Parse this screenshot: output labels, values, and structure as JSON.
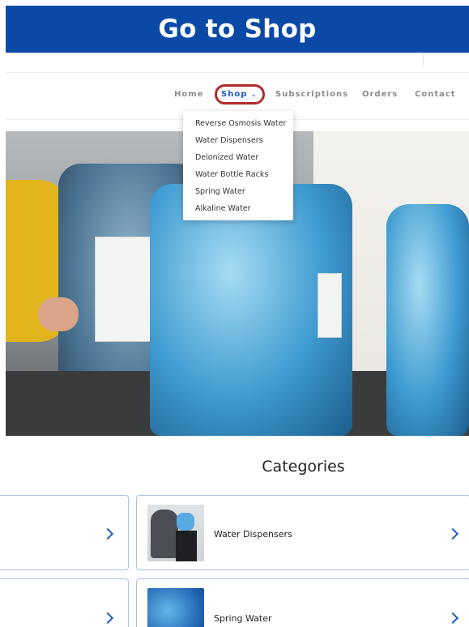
{
  "banner": {
    "title": "Go to Shop"
  },
  "nav": {
    "home": "Home",
    "shop": "Shop",
    "subscriptions": "Subscriptions",
    "orders": "Orders",
    "contact": "Contact",
    "shop_chevron_icon": "chevron-down-icon"
  },
  "shop_menu": {
    "items": [
      "Reverse Osmosis Water",
      "Water Dispensers",
      "Deionized Water",
      "Water Bottle Racks",
      "Spring Water",
      "Alkaline Water"
    ]
  },
  "categories": {
    "title": "Categories",
    "cards": [
      {
        "label": ""
      },
      {
        "label": "Water Dispensers"
      },
      {
        "label": ""
      },
      {
        "label": "Spring Water"
      }
    ]
  },
  "colors": {
    "banner_bg": "#0a4aa6",
    "nav_active": "#1f55c6",
    "highlight_ring": "#b32a2a",
    "card_border": "#a9c1e6",
    "chevron": "#1f5cc6"
  }
}
